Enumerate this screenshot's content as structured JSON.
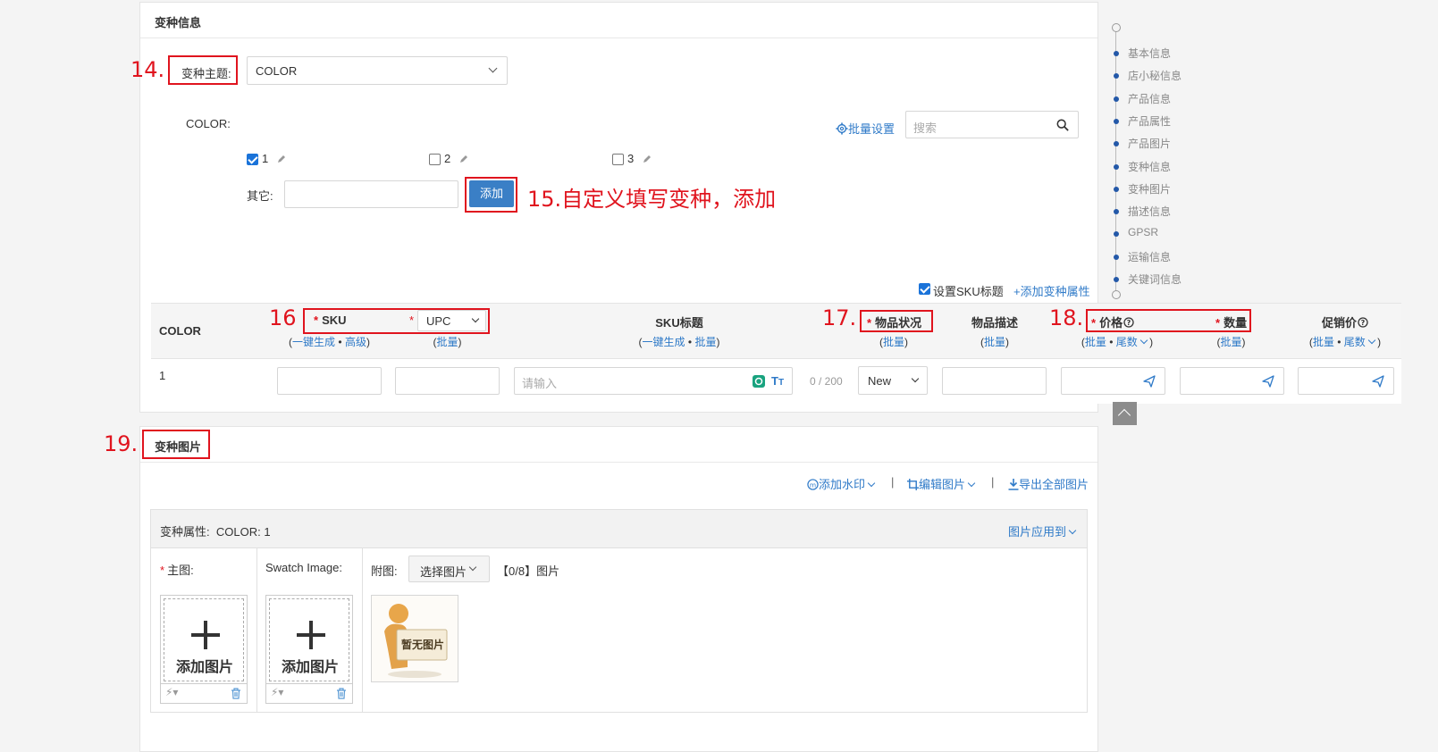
{
  "variant_section": {
    "title": "变种信息",
    "theme_label": "变种主题:",
    "theme_value": "COLOR",
    "color_label": "COLOR:",
    "batch_settings": "批量设置",
    "search_placeholder": "搜索",
    "options": [
      {
        "label": "1",
        "checked": true
      },
      {
        "label": "2",
        "checked": false
      },
      {
        "label": "3",
        "checked": false
      }
    ],
    "other_label": "其它:",
    "add_button": "添加",
    "set_sku_title_label": "设置SKU标题",
    "set_sku_title_checked": true,
    "add_variant_attr": "+添加变种属性"
  },
  "annotations": {
    "n14": "14.",
    "n15": "15.自定义填写变种，添加",
    "n16": "16",
    "n17": "17.",
    "n18": "18.",
    "n19": "19."
  },
  "table": {
    "col_color": "COLOR",
    "col_sku": "SKU",
    "col_upc": "UPC",
    "col_sku_title": "SKU标题",
    "col_condition": "物品状况",
    "col_desc": "物品描述",
    "col_price": "价格",
    "col_qty": "数量",
    "col_promo": "促销价",
    "one_click": "一键生成",
    "advanced": "高级",
    "batch": "批量",
    "tail": "尾数",
    "dot": "•",
    "open_paren": "(",
    "close_paren": ")",
    "row": {
      "color": "1",
      "title_placeholder": "请输入",
      "count": "0 / 200",
      "condition": "New"
    }
  },
  "image_section": {
    "title": "变种图片",
    "add_watermark": "添加水印",
    "edit_image": "编辑图片",
    "export_all": "导出全部图片",
    "sep": "|",
    "attr_label": "变种属性:",
    "attr_value": "COLOR: 1",
    "apply_to": "图片应用到",
    "main_image_label": "主图:",
    "swatch_label": "Swatch Image:",
    "attached_label": "附图:",
    "choose_image": "选择图片",
    "count_label": "【0/8】图片",
    "add_image_text": "添加图片",
    "no_image_text": "暂无图片"
  },
  "right_nav": {
    "items": [
      "基本信息",
      "店小秘信息",
      "产品信息",
      "产品属性",
      "产品图片",
      "变种信息",
      "变种图片",
      "描述信息",
      "GPSR",
      "运输信息",
      "关键词信息"
    ]
  },
  "colors": {
    "accent": "#2f7ac8",
    "annotation_red": "#e0141e",
    "add_button": "#3a7fc6"
  }
}
